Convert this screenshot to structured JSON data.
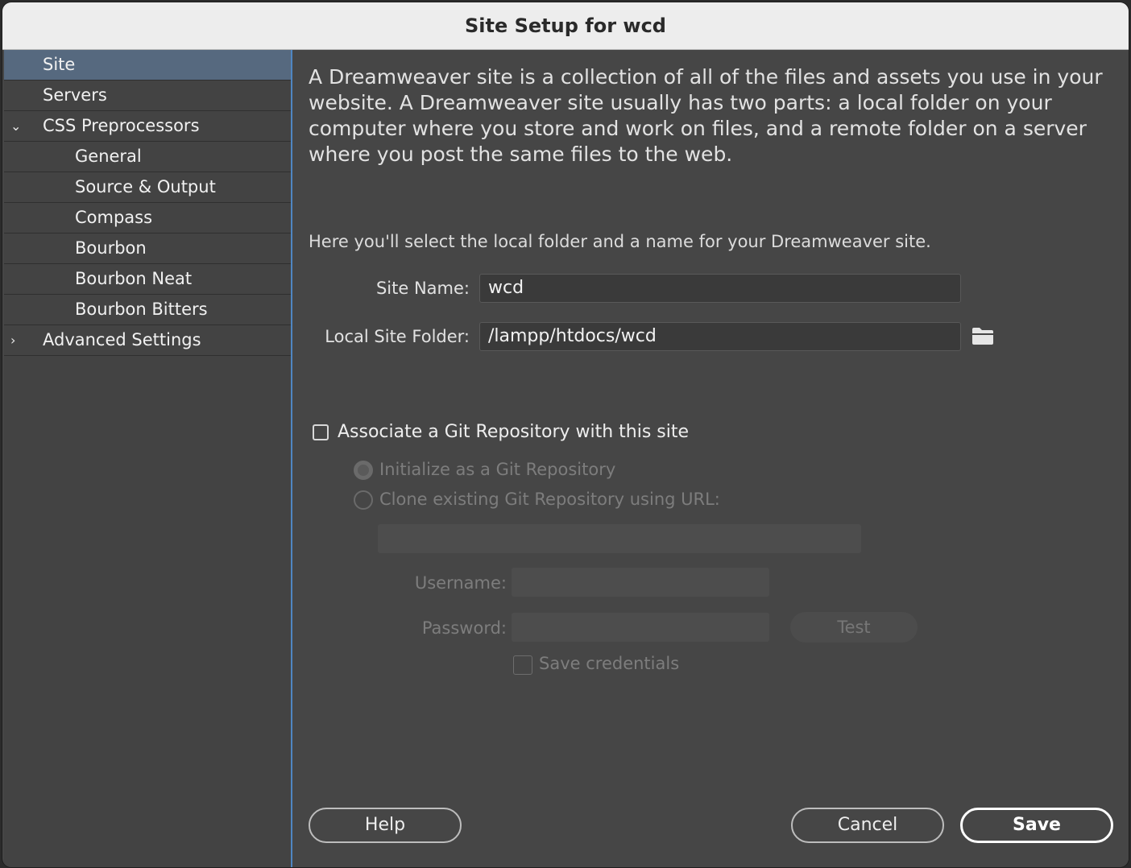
{
  "window": {
    "title": "Site Setup for wcd"
  },
  "sidebar": {
    "items": [
      {
        "label": "Site",
        "selected": true,
        "level": 0,
        "chevron": ""
      },
      {
        "label": "Servers",
        "level": 0,
        "chevron": ""
      },
      {
        "label": "CSS Preprocessors",
        "level": 0,
        "chevron": "⌄"
      },
      {
        "label": "General",
        "level": 1
      },
      {
        "label": "Source & Output",
        "level": 1
      },
      {
        "label": "Compass",
        "level": 1
      },
      {
        "label": "Bourbon",
        "level": 1
      },
      {
        "label": "Bourbon Neat",
        "level": 1
      },
      {
        "label": "Bourbon Bitters",
        "level": 1
      },
      {
        "label": "Advanced Settings",
        "level": 0,
        "chevron": "›"
      }
    ]
  },
  "main": {
    "intro": "A Dreamweaver site is a collection of all of the files and assets you use in your website. A Dreamweaver site usually has two parts: a local folder on your computer where you store and work on files, and a remote folder on a server where you post the same files to the web.",
    "subtext": "Here you'll select the local folder and a name for your Dreamweaver site.",
    "site_name_label": "Site Name:",
    "site_name_value": "wcd",
    "local_folder_label": "Local Site Folder:",
    "local_folder_value": "/lampp/htdocs/wcd",
    "folder_icon": "folder-icon",
    "git": {
      "associate_label": "Associate a Git Repository with this site",
      "associate_checked": false,
      "init_label": "Initialize as a Git Repository",
      "clone_label": "Clone existing Git Repository using URL:",
      "url_value": "",
      "username_label": "Username:",
      "username_value": "",
      "password_label": "Password:",
      "password_value": "",
      "test_label": "Test",
      "save_credentials_label": "Save credentials"
    }
  },
  "footer": {
    "help_label": "Help",
    "cancel_label": "Cancel",
    "save_label": "Save"
  },
  "colors": {
    "sidebar_selected": "#56697f",
    "panel_background": "#464646",
    "accent_border": "#4f86c2"
  }
}
